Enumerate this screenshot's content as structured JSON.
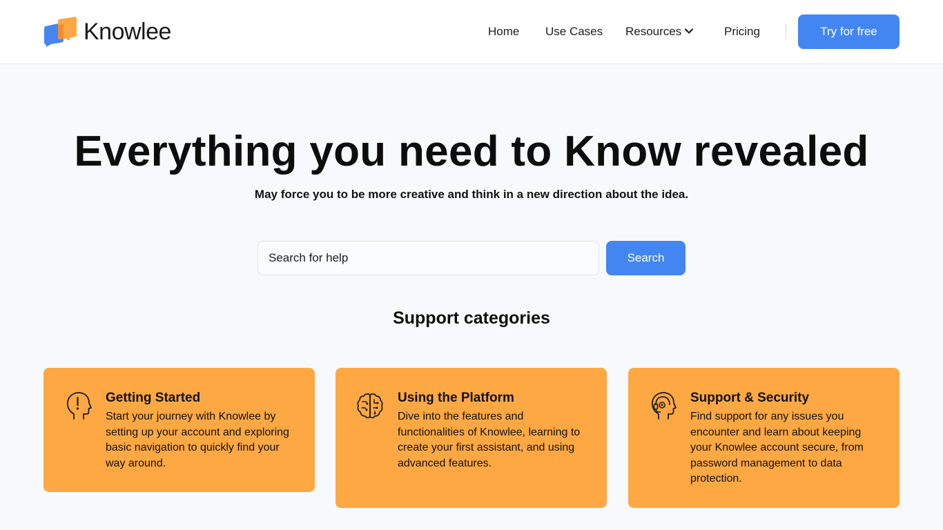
{
  "brand": {
    "name": "Knowlee",
    "logo_icon": "chat-bubbles-logo-icon",
    "colors": {
      "blue": "#4386f1",
      "orange": "#fda843"
    }
  },
  "nav": {
    "items": [
      {
        "label": "Home"
      },
      {
        "label": "Use Cases"
      },
      {
        "label": "Resources",
        "icon": "chevron-down-icon"
      },
      {
        "label": "Pricing"
      }
    ],
    "cta_label": "Try for free"
  },
  "hero": {
    "title": "Everything you need to Know revealed",
    "subtitle": "May force you to be more creative and think in a new direction about the idea."
  },
  "search": {
    "placeholder": "Search for help",
    "button_label": "Search"
  },
  "categories": {
    "title": "Support categories",
    "items": [
      {
        "icon": "head-exclamation-icon",
        "title": "Getting Started",
        "description": "Start your journey with Knowlee by setting up your account and exploring basic navigation to quickly find your way around."
      },
      {
        "icon": "brain-circuit-icon",
        "title": "Using the Platform",
        "description": "Dive into the features and functionalities of Knowlee, learning to create your first assistant, and using advanced features."
      },
      {
        "icon": "head-headset-icon",
        "title": "Support & Security",
        "description": "Find support for any issues you encounter and learn about keeping your Knowlee account secure, from password management to data protection."
      }
    ]
  }
}
